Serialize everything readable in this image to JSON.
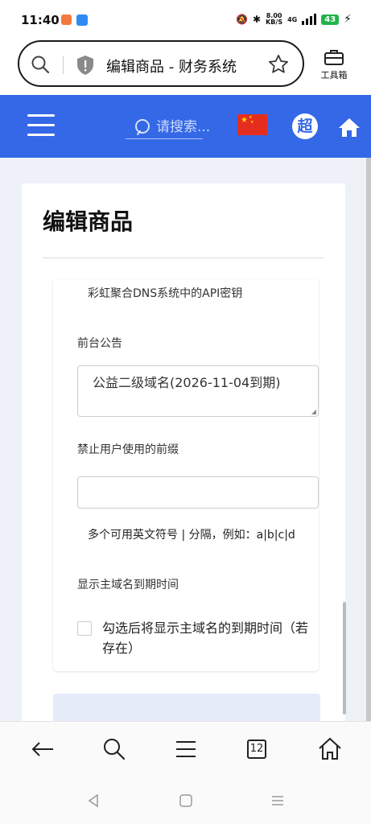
{
  "status_bar": {
    "time": "11:40",
    "net_speed": "8.00",
    "net_unit": "KB/S",
    "network": "4G",
    "battery": "43"
  },
  "address_bar": {
    "title": "编辑商品 - 财务系统",
    "toolbox_label": "工具箱"
  },
  "site_header": {
    "search_placeholder": "请搜索...",
    "avatar_letter": "超"
  },
  "card": {
    "title": "编辑商品"
  },
  "form": {
    "api_key_hint": "彩虹聚合DNS系统中的API密钥",
    "notice_label": "前台公告",
    "notice_value": "公益二级域名(2026-11-04到期)",
    "prefix_label": "禁止用户使用的前缀",
    "prefix_value": "",
    "prefix_hint": "多个可用英文符号 | 分隔，例如：a|b|c|d",
    "expire_label": "显示主域名到期时间",
    "expire_checkbox_label": "勾选后将显示主域名的到期时间（若存在）"
  },
  "browser_nav": {
    "tab_count": "12"
  },
  "colors": {
    "brand_blue": "#3468e7",
    "page_bg": "#eef1f7"
  }
}
